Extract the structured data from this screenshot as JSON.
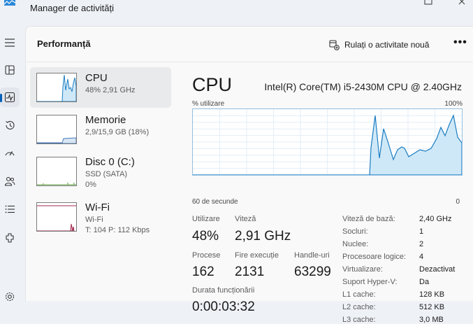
{
  "window": {
    "title": "Manager de activități"
  },
  "header": {
    "page_title": "Performanță",
    "new_task_label": "Rulați o activitate nouă",
    "more_label": "•••"
  },
  "resources": [
    {
      "name": "CPU",
      "line1": "48% 2,91 GHz",
      "line2": "",
      "line3": ""
    },
    {
      "name": "Memorie",
      "line1": "2,9/15,9 GB (18%)",
      "line2": "",
      "line3": ""
    },
    {
      "name": "Disc 0 (C:)",
      "line1": "SSD (SATA)",
      "line2": "0%",
      "line3": ""
    },
    {
      "name": "Wi-Fi",
      "line1": "Wi-Fi",
      "line2": "T: 104 P: 112 Kbps",
      "line3": ""
    }
  ],
  "detail": {
    "title": "CPU",
    "model": "Intel(R) Core(TM) i5-2430M CPU @ 2.40GHz",
    "graph_label_top_left": "% utilizare",
    "graph_label_top_right": "100%",
    "graph_label_bottom_left": "60 de secunde",
    "graph_label_bottom_right": "0",
    "stats": {
      "utilization_label": "Utilizare",
      "utilization_value": "48%",
      "speed_label": "Viteză",
      "speed_value": "2,91 GHz",
      "processes_label": "Procese",
      "processes_value": "162",
      "threads_label": "Fire execuție",
      "threads_value": "2131",
      "handles_label": "Handle-uri",
      "handles_value": "63299",
      "uptime_label": "Durata funcționării",
      "uptime_value": "0:00:03:32"
    },
    "specs": [
      {
        "label": "Viteză de bază:",
        "value": "2,40 GHz"
      },
      {
        "label": "Socluri:",
        "value": "1"
      },
      {
        "label": "Nuclee:",
        "value": "2"
      },
      {
        "label": "Procesoare logice:",
        "value": "4"
      },
      {
        "label": "Virtualizare:",
        "value": "Dezactivat"
      },
      {
        "label": "Suport Hyper-V:",
        "value": "Da"
      },
      {
        "label": "L1 cache:",
        "value": "128 KB"
      },
      {
        "label": "L2 cache:",
        "value": "512 KB"
      },
      {
        "label": "L3 cache:",
        "value": "3,0 MB"
      }
    ]
  },
  "colors": {
    "accent": "#005fb8",
    "cpu_line": "#1b7ec2",
    "cpu_fill": "#cfe8f8",
    "wifi_line": "#a0294d"
  },
  "icons": [
    "app-icon",
    "hamburger-icon",
    "processes-icon",
    "performance-icon",
    "history-icon",
    "startup-icon",
    "users-icon",
    "details-icon",
    "services-icon",
    "settings-icon",
    "new-task-icon"
  ]
}
